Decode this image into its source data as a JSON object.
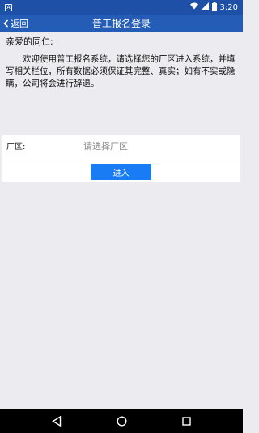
{
  "status_bar": {
    "time": "3:20",
    "app_icon_glyph": "A",
    "icons": [
      "app-notification-icon",
      "wifi-icon",
      "signal-icon",
      "battery-icon"
    ]
  },
  "nav": {
    "back_label": "返回",
    "title": "普工报名登录"
  },
  "content": {
    "greeting": "亲爱的同仁:",
    "notice": "欢迎使用普工报名系统，请选择您的厂区进入系统，并填写相关栏位，所有数据必须保证其完整、真实；如有不实或隐瞒，公司将会进行辞退。"
  },
  "form": {
    "factory_label": "厂区:",
    "factory_placeholder": "请选择厂区",
    "enter_label": "进入"
  },
  "colors": {
    "status_bar": "#1e50a8",
    "nav_bar": "#245cb6",
    "background": "#ececf0",
    "button": "#1a7cf4"
  },
  "system_nav": [
    "back-triangle-icon",
    "home-circle-icon",
    "recents-square-icon"
  ]
}
